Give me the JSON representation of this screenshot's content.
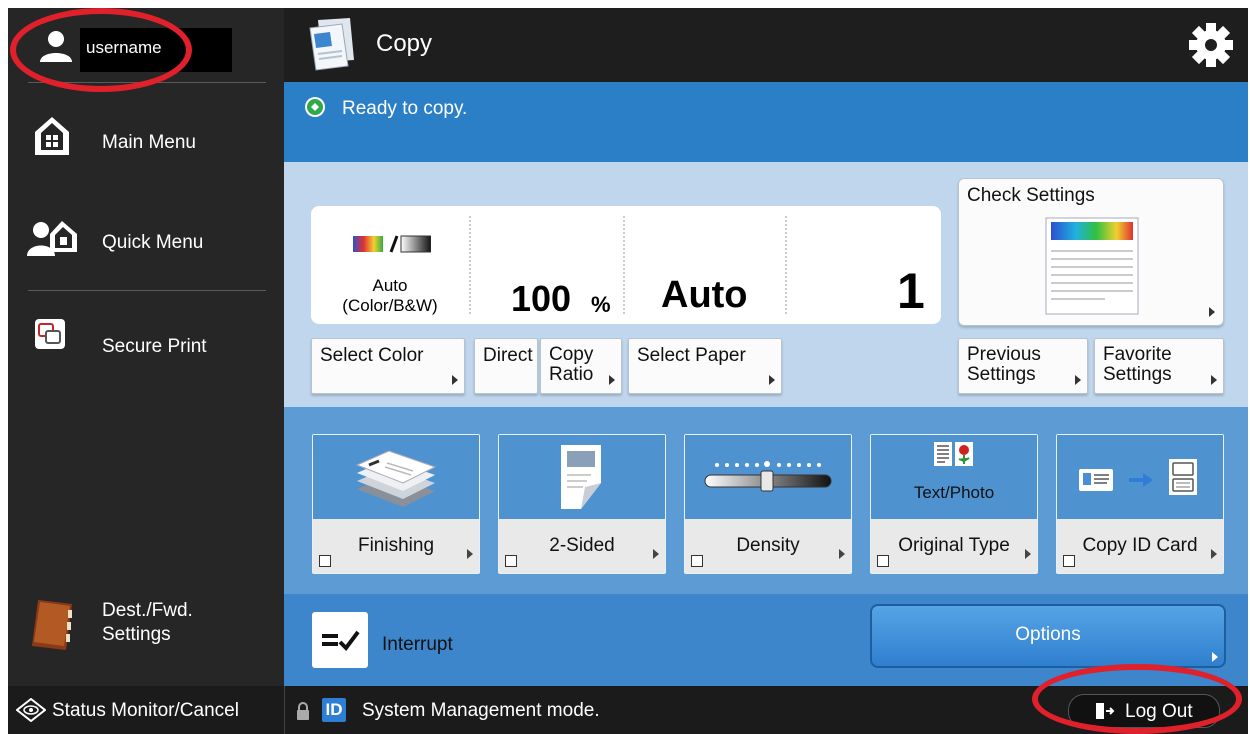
{
  "sidebar": {
    "username": "username",
    "items": [
      {
        "label": "Main Menu",
        "icon": "home-icon"
      },
      {
        "label": "Quick Menu",
        "icon": "quick-menu-icon"
      },
      {
        "label": "Secure Print",
        "icon": "secure-print-icon"
      }
    ],
    "dest_line1": "Dest./Fwd.",
    "dest_line2": "Settings"
  },
  "header": {
    "title": "Copy"
  },
  "status": {
    "ready_text": "Ready to copy."
  },
  "settings_summary": {
    "color_line1": "Auto",
    "color_line2": "(Color/B&W)",
    "ratio_value": "100",
    "ratio_unit": "%",
    "paper": "Auto",
    "copies": "1"
  },
  "buttons": {
    "select_color": "Select Color",
    "direct": "Direct",
    "copy_ratio_line1": "Copy",
    "copy_ratio_line2": "Ratio",
    "select_paper": "Select Paper",
    "check_settings": "Check Settings",
    "previous_line1": "Previous",
    "previous_line2": "Settings",
    "favorite_line1": "Favorite",
    "favorite_line2": "Settings"
  },
  "functions": [
    {
      "label": "Finishing",
      "icon": "finishing-icon"
    },
    {
      "label": "2-Sided",
      "icon": "two-sided-icon"
    },
    {
      "label": "Density",
      "icon": "density-icon"
    },
    {
      "label": "Original Type",
      "icon": "original-type-icon",
      "sub": "Text/Photo"
    },
    {
      "label": "Copy ID Card",
      "icon": "copy-id-card-icon"
    }
  ],
  "bottom": {
    "interrupt": "Interrupt",
    "options": "Options"
  },
  "statusbar": {
    "monitor": "Status Monitor/Cancel",
    "id_badge": "ID",
    "mode_text": "System Management mode.",
    "logout": "Log Out"
  },
  "colors": {
    "ready_band": "#2b7fc6",
    "settings_band": "#bfd6ec",
    "function_band": "#5c9bd3",
    "annotation_red": "#e0202a"
  }
}
